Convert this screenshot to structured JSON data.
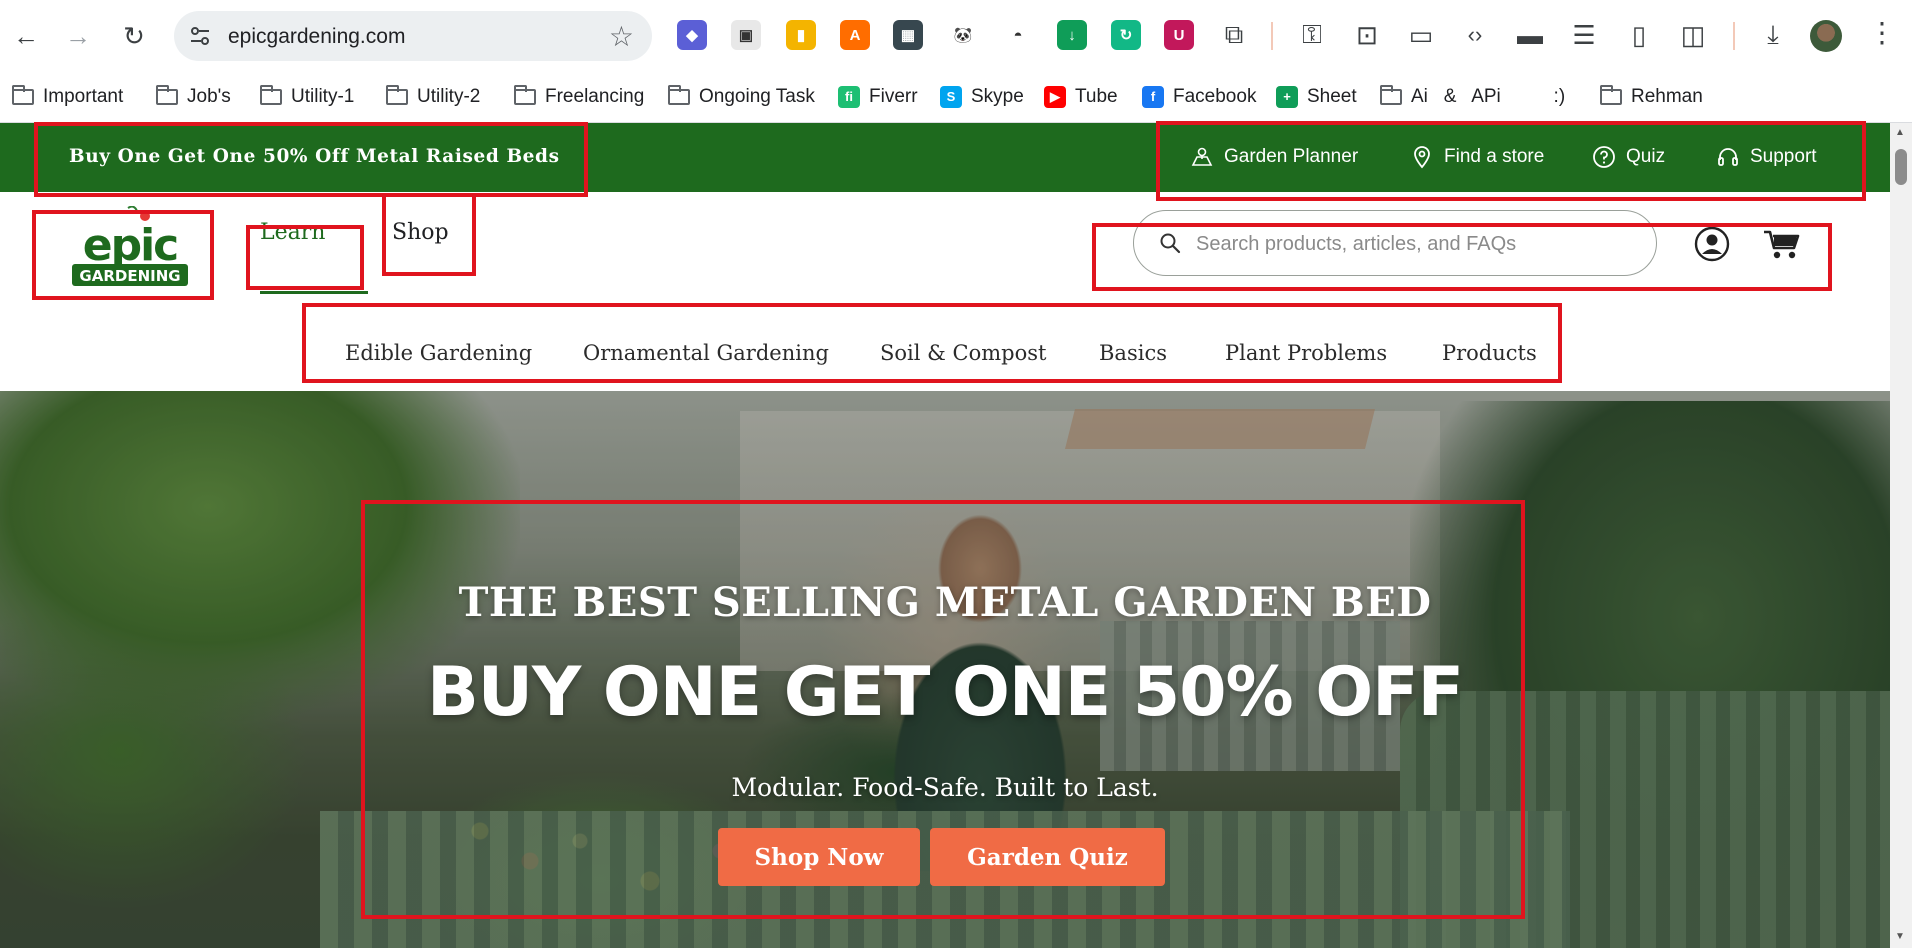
{
  "browser": {
    "url": "epicgardening.com",
    "extensions": [
      {
        "name": "ext-1",
        "color": "#5b5fd6",
        "glyph": "◆"
      },
      {
        "name": "ext-2",
        "color": "#e8e8e8",
        "glyph": "▣"
      },
      {
        "name": "ext-3",
        "color": "#f4b400",
        "glyph": "▮"
      },
      {
        "name": "ext-4",
        "color": "#ff6d00",
        "glyph": "A"
      },
      {
        "name": "ext-5",
        "color": "#37474f",
        "glyph": "▦"
      },
      {
        "name": "ext-6",
        "color": "#ffffff",
        "glyph": "🐼"
      },
      {
        "name": "ext-7",
        "color": "#ffffff",
        "glyph": "◓"
      },
      {
        "name": "ext-8",
        "color": "#0f9d58",
        "glyph": "↓"
      },
      {
        "name": "ext-9",
        "color": "#12b886",
        "glyph": "↻"
      },
      {
        "name": "ext-10",
        "color": "#c2185b",
        "glyph": "U"
      }
    ]
  },
  "bookmarks": [
    {
      "label": "Important",
      "type": "folder"
    },
    {
      "label": "Job's",
      "type": "folder"
    },
    {
      "label": "Utility-1",
      "type": "folder"
    },
    {
      "label": "Utility-2",
      "type": "folder"
    },
    {
      "label": "Freelancing",
      "type": "folder"
    },
    {
      "label": "Ongoing Task",
      "type": "folder"
    },
    {
      "label": "Fiverr",
      "type": "site",
      "icon": "fiverr-icon",
      "color": "#1dbf73"
    },
    {
      "label": "Skype",
      "type": "site",
      "icon": "skype-icon",
      "color": "#00a4ef"
    },
    {
      "label": "Tube",
      "type": "site",
      "icon": "youtube-icon",
      "color": "#ff0000"
    },
    {
      "label": "Facebook",
      "type": "site",
      "icon": "facebook-icon",
      "color": "#1877f2"
    },
    {
      "label": "Sheet",
      "type": "site",
      "icon": "sheets-icon",
      "color": "#0f9d58"
    },
    {
      "label": "Ai   &   APi          :)",
      "type": "folder"
    },
    {
      "label": "Rehman",
      "type": "folder"
    }
  ],
  "site": {
    "promo_bar": {
      "text": "Buy One Get One 50% Off Metal Raised Beds",
      "background": "#1e6a1e"
    },
    "top_links": [
      {
        "label": "Garden Planner",
        "icon": "planner-icon"
      },
      {
        "label": "Find a store",
        "icon": "location-pin-icon"
      },
      {
        "label": "Quiz",
        "icon": "question-circle-icon"
      },
      {
        "label": "Support",
        "icon": "headset-icon"
      }
    ],
    "logo": {
      "line1": "epic",
      "line2": "GARDENING"
    },
    "main_nav": {
      "learn": "Learn",
      "shop": "Shop"
    },
    "search": {
      "placeholder": "Search products, articles, and FAQs"
    },
    "sub_nav": [
      "Edible Gardening",
      "Ornamental Gardening",
      "Soil & Compost",
      "Basics",
      "Plant Problems",
      "Products"
    ],
    "hero": {
      "kicker": "THE BEST SELLING METAL GARDEN BED",
      "headline": "BUY ONE GET ONE 50% OFF",
      "subheadline": "Modular. Food-Safe. Built to Last.",
      "cta_primary": "Shop Now",
      "cta_secondary": "Garden Quiz",
      "cta_color": "#f06b45"
    }
  },
  "annotation_color": "#e0141e"
}
